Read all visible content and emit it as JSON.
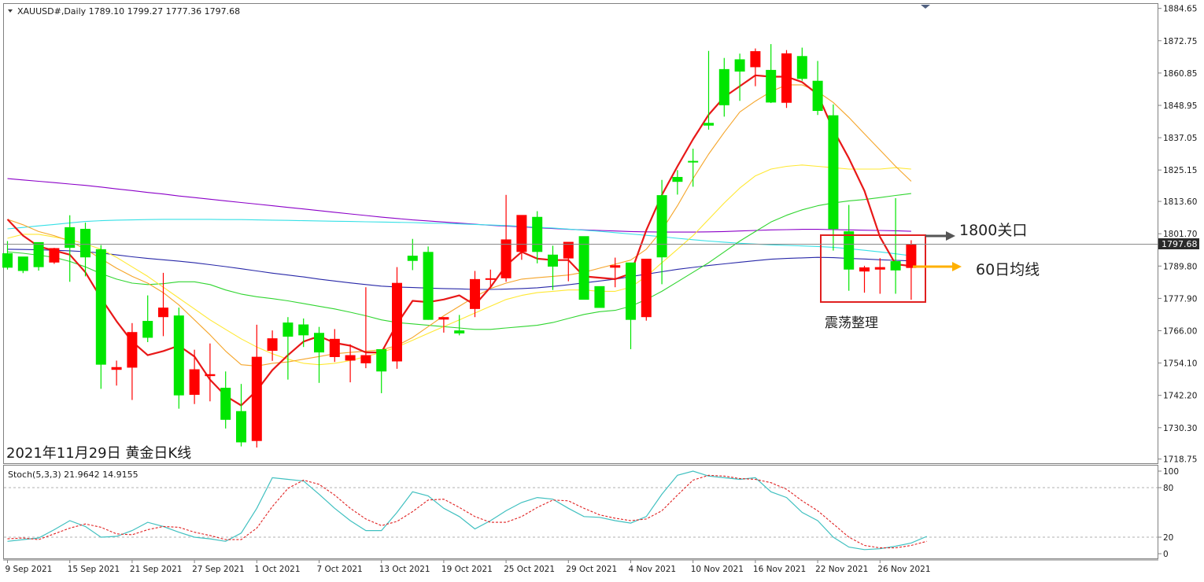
{
  "chart_data": {
    "type": "candlestick",
    "symbol_line": "XAUUSD#,Daily  1789.10 1799.27 1777.36 1797.68",
    "current_price_label": "1797.68",
    "price_ticks": [
      "1884.65",
      "1872.75",
      "1860.85",
      "1848.95",
      "1837.05",
      "1825.15",
      "1813.60",
      "1801.70",
      "1789.80",
      "1777.90",
      "1766.00",
      "1754.10",
      "1742.20",
      "1730.30",
      "1718.75"
    ],
    "price_range": [
      1717.5,
      1886.0
    ],
    "oscillator": {
      "label": "Stoch(5,3,3) 21.9642 14.9155",
      "range": [
        0,
        100
      ],
      "ticks": [
        "100",
        "80",
        "20",
        "0"
      ],
      "levels": [
        80,
        20
      ],
      "main": [
        15,
        17,
        19,
        29,
        40,
        33,
        20,
        21,
        28,
        38,
        33,
        26,
        20,
        18,
        15,
        25,
        55,
        92,
        90,
        88,
        72,
        55,
        40,
        28,
        28,
        50,
        75,
        70,
        55,
        45,
        30,
        40,
        52,
        62,
        68,
        66,
        55,
        45,
        44,
        40,
        37,
        45,
        72,
        95,
        100,
        94,
        92,
        90,
        92,
        75,
        68,
        50,
        40,
        20,
        8,
        5,
        6,
        9,
        13,
        21
      ],
      "signal": [
        18,
        19,
        17,
        24,
        31,
        36,
        32,
        24,
        23,
        29,
        33,
        32,
        26,
        22,
        17,
        17,
        31,
        57,
        79,
        89,
        84,
        71,
        55,
        42,
        34,
        39,
        51,
        65,
        66,
        56,
        45,
        38,
        38,
        45,
        56,
        65,
        64,
        55,
        47,
        43,
        40,
        42,
        52,
        71,
        89,
        95,
        94,
        91,
        90,
        86,
        78,
        64,
        52,
        36,
        20,
        10,
        7,
        7,
        10,
        15
      ]
    },
    "date_labels": [
      [
        "9 Sep 2021",
        0
      ],
      [
        "15 Sep 2021",
        4
      ],
      [
        "21 Sep 2021",
        8
      ],
      [
        "27 Sep 2021",
        12
      ],
      [
        "1 Oct 2021",
        16
      ],
      [
        "7 Oct 2021",
        20
      ],
      [
        "13 Oct 2021",
        24
      ],
      [
        "19 Oct 2021",
        28
      ],
      [
        "25 Oct 2021",
        32
      ],
      [
        "29 Oct 2021",
        36
      ],
      [
        "4 Nov 2021",
        40
      ],
      [
        "10 Nov 2021",
        44
      ],
      [
        "16 Nov 2021",
        48
      ],
      [
        "22 Nov 2021",
        52
      ],
      [
        "26 Nov 2021",
        56
      ]
    ],
    "candles": [
      [
        1794.5,
        1799.0,
        1788.5,
        1789.2
      ],
      [
        1793.3,
        1792.0,
        1787.2,
        1788.0
      ],
      [
        1798.6,
        1796.0,
        1788.1,
        1789.4
      ],
      [
        1791.1,
        1796.5,
        1790.6,
        1796.4
      ],
      [
        1804.1,
        1808.5,
        1784.0,
        1796.5
      ],
      [
        1803.5,
        1805.8,
        1786.0,
        1793.0
      ],
      [
        1796.0,
        1797.5,
        1744.6,
        1753.5
      ],
      [
        1751.6,
        1755.0,
        1745.8,
        1752.6
      ],
      [
        1752.4,
        1768.8,
        1740.5,
        1765.5
      ],
      [
        1769.6,
        1779.0,
        1761.8,
        1763.4
      ],
      [
        1771.0,
        1787.3,
        1764.0,
        1774.5
      ],
      [
        1771.6,
        1774.5,
        1737.3,
        1742.2
      ],
      [
        1742.4,
        1759.0,
        1739.0,
        1751.8
      ],
      [
        1749.3,
        1761.3,
        1740.0,
        1750.0
      ],
      [
        1745.0,
        1751.0,
        1730.0,
        1733.2
      ],
      [
        1736.4,
        1746.4,
        1723.4,
        1724.9
      ],
      [
        1725.4,
        1768.2,
        1723.0,
        1756.4
      ],
      [
        1758.6,
        1766.1,
        1754.9,
        1763.2
      ],
      [
        1769.0,
        1771.0,
        1748.0,
        1763.8
      ],
      [
        1768.3,
        1770.5,
        1760.0,
        1764.3
      ],
      [
        1765.2,
        1767.4,
        1746.8,
        1758.0
      ],
      [
        1756.3,
        1766.6,
        1754.5,
        1763.0
      ],
      [
        1755.0,
        1761.0,
        1747.0,
        1757.0
      ],
      [
        1754.0,
        1782.0,
        1752.2,
        1757.0
      ],
      [
        1759.2,
        1758.0,
        1743.0,
        1751.0
      ],
      [
        1754.7,
        1789.4,
        1752.0,
        1783.6
      ],
      [
        1793.6,
        1799.8,
        1788.3,
        1791.7
      ],
      [
        1795.0,
        1797.0,
        1770.0,
        1770.0
      ],
      [
        1770.1,
        1771.0,
        1765.3,
        1771.0
      ],
      [
        1766.1,
        1771.8,
        1764.3,
        1765.0
      ],
      [
        1774.0,
        1788.0,
        1771.0,
        1785.0
      ],
      [
        1785.2,
        1788.5,
        1782.0,
        1785.3
      ],
      [
        1785.3,
        1816.0,
        1784.0,
        1799.6
      ],
      [
        1795.0,
        1796.6,
        1792.1,
        1808.6
      ],
      [
        1807.9,
        1810.0,
        1790.8,
        1795.0
      ],
      [
        1794.0,
        1797.3,
        1781.0,
        1789.6
      ],
      [
        1792.6,
        1798.1,
        1784.2,
        1798.7
      ],
      [
        1800.8,
        1798.9,
        1778.6,
        1777.4
      ],
      [
        1782.4,
        1782.0,
        1776.8,
        1774.4
      ],
      [
        1789.2,
        1792.9,
        1782.0,
        1790.1
      ],
      [
        1791.1,
        1789.8,
        1759.2,
        1770.0
      ],
      [
        1771.0,
        1778.1,
        1769.7,
        1792.5
      ],
      [
        1815.9,
        1821.5,
        1783.1,
        1793.0
      ],
      [
        1822.6,
        1825.1,
        1816.1,
        1820.8
      ],
      [
        1828.5,
        1833.0,
        1819.0,
        1828.2
      ],
      [
        1842.5,
        1869.0,
        1840.0,
        1841.5
      ],
      [
        1862.3,
        1866.4,
        1844.8,
        1849.0
      ],
      [
        1865.9,
        1868.0,
        1850.6,
        1861.4
      ],
      [
        1863.0,
        1869.9,
        1856.0,
        1868.9
      ],
      [
        1862.0,
        1871.5,
        1849.8,
        1850.0
      ],
      [
        1849.9,
        1869.3,
        1848.0,
        1868.1
      ],
      [
        1867.1,
        1870.2,
        1858.0,
        1858.7
      ],
      [
        1858.0,
        1865.3,
        1845.4,
        1846.9
      ],
      [
        1845.3,
        1849.3,
        1795.5,
        1803.4
      ],
      [
        1802.6,
        1812.3,
        1780.7,
        1788.5
      ],
      [
        1787.8,
        1789.9,
        1780.0,
        1789.3
      ],
      [
        1788.5,
        1792.7,
        1779.6,
        1789.4
      ],
      [
        1791.6,
        1814.8,
        1779.6,
        1788.2
      ],
      [
        1789.1,
        1799.3,
        1777.4,
        1797.7
      ]
    ],
    "moving_averages": [
      {
        "color": "#8b00c8",
        "values": [
          1822.0,
          1821.5,
          1821.0,
          1820.5,
          1820.0,
          1819.5,
          1818.9,
          1818.2,
          1817.6,
          1816.9,
          1816.3,
          1815.6,
          1815.0,
          1814.4,
          1813.8,
          1813.2,
          1812.6,
          1812.0,
          1811.4,
          1810.8,
          1810.2,
          1809.6,
          1809.0,
          1808.4,
          1807.8,
          1807.3,
          1806.8,
          1806.4,
          1806.0,
          1805.6,
          1805.2,
          1804.8,
          1804.5,
          1804.2,
          1803.9,
          1803.6,
          1803.3,
          1803.1,
          1802.9,
          1802.7,
          1802.5,
          1802.4,
          1802.3,
          1802.3,
          1802.3,
          1802.4,
          1802.5,
          1802.7,
          1802.9,
          1803.1,
          1803.2,
          1803.3,
          1803.3,
          1803.2,
          1803.1,
          1803.0,
          1802.9,
          1802.8,
          1802.6
        ]
      },
      {
        "color": "#36e0e6",
        "values": [
          1803.5,
          1804.0,
          1804.6,
          1805.1,
          1805.7,
          1806.2,
          1806.5,
          1806.7,
          1806.8,
          1806.9,
          1807.0,
          1807.0,
          1807.0,
          1807.0,
          1806.9,
          1806.9,
          1806.8,
          1806.7,
          1806.6,
          1806.5,
          1806.4,
          1806.3,
          1806.2,
          1806.1,
          1806.0,
          1805.9,
          1805.8,
          1805.6,
          1805.5,
          1805.3,
          1805.1,
          1804.9,
          1804.7,
          1804.4,
          1804.1,
          1803.8,
          1803.4,
          1803.0,
          1802.6,
          1802.1,
          1801.6,
          1801.1,
          1800.6,
          1800.0,
          1799.5,
          1799.0,
          1798.6,
          1798.2,
          1797.9,
          1797.6,
          1797.4,
          1797.2,
          1797.0,
          1796.7,
          1796.2,
          1795.6,
          1795.0,
          1794.3,
          1793.6
        ]
      },
      {
        "color": "#2828a8",
        "values": [
          1796.0,
          1795.9,
          1795.8,
          1795.6,
          1795.4,
          1795.1,
          1794.6,
          1793.9,
          1793.2,
          1792.6,
          1792.1,
          1791.6,
          1791.0,
          1790.3,
          1789.6,
          1788.8,
          1788.0,
          1787.2,
          1786.5,
          1785.8,
          1785.0,
          1784.3,
          1783.6,
          1783.0,
          1782.4,
          1782.1,
          1781.9,
          1781.7,
          1781.5,
          1781.4,
          1781.2,
          1781.2,
          1781.3,
          1781.5,
          1781.8,
          1782.3,
          1782.9,
          1783.6,
          1784.3,
          1785.0,
          1785.9,
          1786.8,
          1787.7,
          1788.6,
          1789.3,
          1790.0,
          1790.6,
          1791.2,
          1791.8,
          1792.3,
          1792.6,
          1792.8,
          1793.0,
          1792.9,
          1792.6,
          1792.4,
          1792.1,
          1791.9,
          1791.7
        ]
      },
      {
        "color": "#30d530",
        "values": [
          1795.0,
          1794.5,
          1793.8,
          1793.0,
          1791.5,
          1789.5,
          1787.0,
          1785.0,
          1783.5,
          1783.0,
          1783.3,
          1784.0,
          1784.0,
          1783.0,
          1781.0,
          1779.5,
          1778.5,
          1777.8,
          1777.0,
          1776.0,
          1775.0,
          1774.0,
          1772.8,
          1771.5,
          1770.0,
          1769.0,
          1768.5,
          1768.0,
          1767.5,
          1767.0,
          1766.5,
          1766.5,
          1767.0,
          1767.5,
          1768.0,
          1769.0,
          1770.5,
          1772.0,
          1773.0,
          1773.5,
          1775.0,
          1777.5,
          1780.5,
          1784.0,
          1787.5,
          1791.0,
          1795.0,
          1799.0,
          1802.5,
          1806.0,
          1808.5,
          1810.5,
          1812.0,
          1813.0,
          1813.8,
          1814.3,
          1815.0,
          1815.8,
          1816.5
        ]
      },
      {
        "color": "#ffe833",
        "values": [
          1800.0,
          1801.5,
          1801.5,
          1800.5,
          1799.5,
          1798.0,
          1796.0,
          1793.0,
          1789.5,
          1786.0,
          1782.0,
          1778.0,
          1774.0,
          1770.0,
          1766.5,
          1763.0,
          1760.0,
          1757.5,
          1755.5,
          1754.0,
          1753.5,
          1754.0,
          1755.0,
          1756.5,
          1758.0,
          1760.0,
          1762.5,
          1765.0,
          1767.5,
          1770.0,
          1772.5,
          1775.0,
          1777.5,
          1779.0,
          1780.0,
          1780.5,
          1781.0,
          1781.0,
          1780.5,
          1780.5,
          1782.0,
          1786.0,
          1791.0,
          1796.0,
          1801.0,
          1807.0,
          1813.0,
          1818.5,
          1823.0,
          1825.5,
          1826.5,
          1827.0,
          1826.5,
          1826.0,
          1825.5,
          1825.5,
          1825.5,
          1826.0,
          1825.5
        ]
      },
      {
        "color": "#f5a52a",
        "values": [
          1807.0,
          1805.0,
          1802.5,
          1801.0,
          1799.0,
          1796.0,
          1792.5,
          1789.0,
          1786.0,
          1783.5,
          1780.0,
          1775.5,
          1770.0,
          1764.5,
          1758.5,
          1753.5,
          1753.0,
          1754.0,
          1754.5,
          1755.5,
          1756.5,
          1757.5,
          1758.0,
          1758.5,
          1759.0,
          1760.5,
          1763.5,
          1767.5,
          1771.5,
          1775.0,
          1778.5,
          1781.5,
          1783.5,
          1785.0,
          1785.5,
          1786.0,
          1786.5,
          1787.5,
          1789.0,
          1790.5,
          1792.0,
          1796.0,
          1803.0,
          1812.0,
          1822.0,
          1831.0,
          1839.0,
          1846.5,
          1850.5,
          1854.0,
          1856.5,
          1856.5,
          1854.0,
          1850.0,
          1844.5,
          1838.5,
          1832.5,
          1826.5,
          1821.0
        ]
      },
      {
        "color": "#e81818",
        "values": [
          1807.0,
          1801.0,
          1797.0,
          1795.5,
          1794.0,
          1787.5,
          1778.0,
          1769.5,
          1762.0,
          1757.0,
          1758.5,
          1760.5,
          1756.5,
          1748.0,
          1742.0,
          1738.5,
          1744.0,
          1751.5,
          1757.0,
          1762.0,
          1764.0,
          1761.5,
          1760.5,
          1758.0,
          1758.0,
          1768.5,
          1777.0,
          1776.5,
          1777.5,
          1779.0,
          1775.5,
          1782.0,
          1790.0,
          1795.0,
          1792.5,
          1792.0,
          1792.0,
          1786.0,
          1785.5,
          1785.0,
          1787.0,
          1803.0,
          1816.0,
          1826.5,
          1836.5,
          1845.5,
          1852.0,
          1856.0,
          1860.0,
          1859.5,
          1859.5,
          1857.5,
          1853.0,
          1840.0,
          1829.5,
          1817.5,
          1800.5,
          1790.5,
          1789.8
        ]
      }
    ],
    "annotations": {
      "box_label": "震荡整理",
      "arrow_1800": "1800关口",
      "arrow_ma60": "60日均线",
      "chart_caption": "2021年11月29日 黄金日K线"
    }
  }
}
